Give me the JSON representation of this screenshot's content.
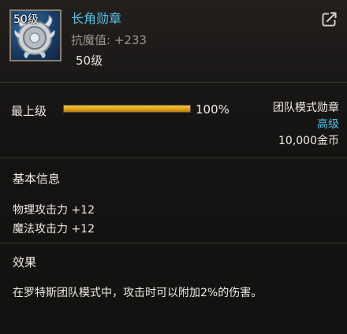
{
  "item": {
    "icon_name": "horn-medal-icon",
    "icon_level": "50级",
    "name": "长角勋章",
    "stat_label": "抗魔值:",
    "stat_value": "+233",
    "level_requirement": "50级",
    "share_icon": "share-icon"
  },
  "grade": {
    "label": "最上级",
    "percent_text": "100%",
    "fill_fraction": 1.0
  },
  "meta": {
    "type": "团队模式勋章",
    "rarity": "高级",
    "price": "10,000金币"
  },
  "basic_info": {
    "title": "基本信息",
    "lines": [
      "物理攻击力 +12",
      "魔法攻击力 +12"
    ]
  },
  "effect": {
    "title": "效果",
    "text": "在罗特斯团队模式中，攻击时可以附加2%的伤害。"
  },
  "colors": {
    "name_color": "#4fc3e6",
    "rarity_color": "#4fc3e6",
    "bar_color": "#e0a31d",
    "icon_border": "#8a8273"
  }
}
